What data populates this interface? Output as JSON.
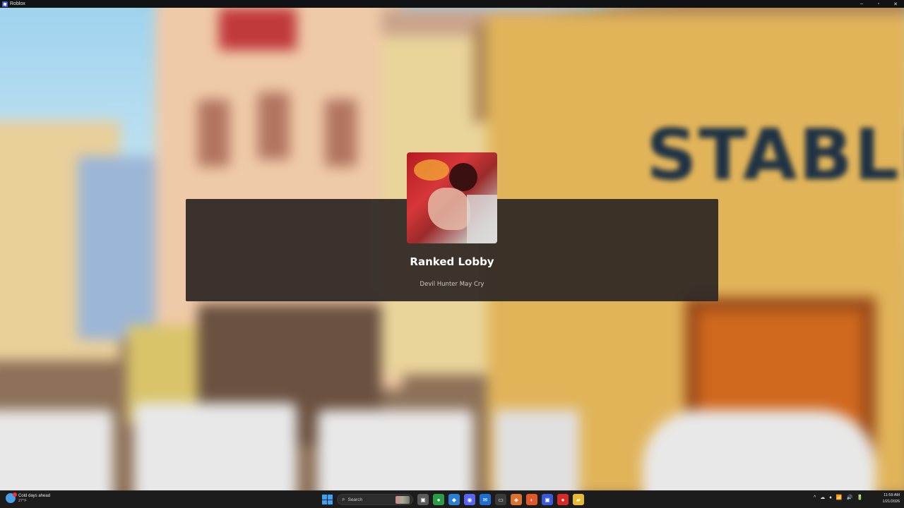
{
  "window": {
    "title": "Roblox",
    "controls": [
      "–",
      "▫",
      "✕"
    ]
  },
  "scene": {
    "sign_text": "STABLE"
  },
  "loading_panel": {
    "place_name": "Ranked Lobby",
    "game_name": "Devil Hunter May Cry"
  },
  "taskbar": {
    "weather_text": "Cold days ahead",
    "weather_temp": "27°F",
    "search_label": "Search",
    "apps": [
      {
        "name": "task-view",
        "color": "#5a5a5a",
        "glyph": "▣"
      },
      {
        "name": "chrome",
        "color": "#2b9b46",
        "glyph": "●"
      },
      {
        "name": "vscode",
        "color": "#2a7fd4",
        "glyph": "◆"
      },
      {
        "name": "discord",
        "color": "#5865f2",
        "glyph": "◉"
      },
      {
        "name": "mail",
        "color": "#1f6fd0",
        "glyph": "✉"
      },
      {
        "name": "terminal",
        "color": "#3a3a3a",
        "glyph": "▭"
      },
      {
        "name": "git",
        "color": "#d9722c",
        "glyph": "◈"
      },
      {
        "name": "firefox",
        "color": "#e2582a",
        "glyph": "◐"
      },
      {
        "name": "roblox-studio",
        "color": "#3a5bd9",
        "glyph": "▣"
      },
      {
        "name": "record",
        "color": "#d92a2a",
        "glyph": "●"
      },
      {
        "name": "explorer",
        "color": "#e8b932",
        "glyph": "▰"
      }
    ],
    "tray": [
      "^",
      "☁",
      "♦",
      "📶",
      "🔊",
      "🔋"
    ],
    "time": "11:59 AM",
    "date": "1/21/2026"
  }
}
